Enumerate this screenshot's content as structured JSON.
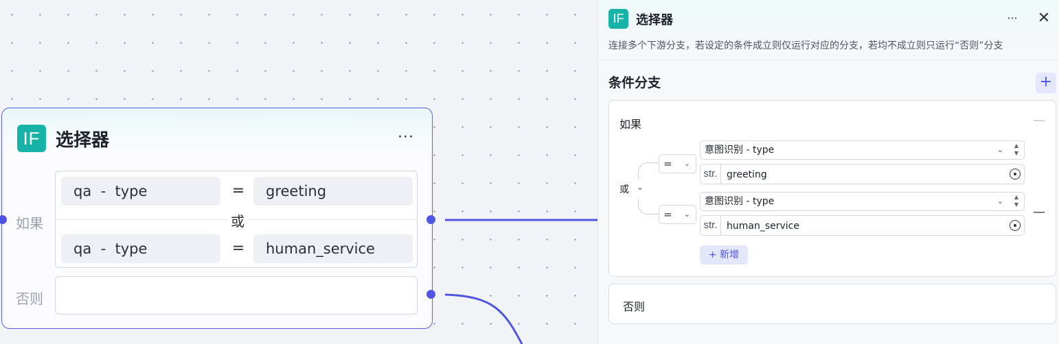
{
  "node": {
    "icon_text": "IF",
    "title": "选择器",
    "more": "···",
    "if_label": "如果",
    "else_label": "否则",
    "or_label": "或",
    "conditions": [
      {
        "var_source": "qa",
        "sep": "-",
        "var_field": "type",
        "operator": "=",
        "value": "greeting"
      },
      {
        "var_source": "qa",
        "sep": "-",
        "var_field": "type",
        "operator": "=",
        "value": "human_service"
      }
    ]
  },
  "panel": {
    "icon_text": "IF",
    "title": "选择器",
    "more": "···",
    "close": "✕",
    "description": "连接多个下游分支，若设定的条件成立则仅运行对应的分支，若均不成立则只运行“否则”分支",
    "section_title": "条件分支",
    "section_add": "+",
    "if_card": {
      "label": "如果",
      "collapse": "—",
      "logic": "或",
      "conditions": [
        {
          "operator": "=",
          "variable": "意图识别 - type",
          "value_type": "str.",
          "value": "greeting"
        },
        {
          "operator": "=",
          "variable": "意图识别 - type",
          "value_type": "str.",
          "value": "human_service"
        }
      ],
      "remove": "—",
      "add_button": "+ 新增"
    },
    "else_card": {
      "label": "否则"
    }
  },
  "colors": {
    "accent": "#4f55e3",
    "icon_bg": "#17b3a8",
    "canvas_bg": "#f2f3f7"
  },
  "icons": [
    "if-node-icon",
    "more-icon",
    "close-icon",
    "plus-icon",
    "chevron-down-icon",
    "spinner-arrows-icon",
    "variable-picker-icon",
    "minus-icon"
  ]
}
